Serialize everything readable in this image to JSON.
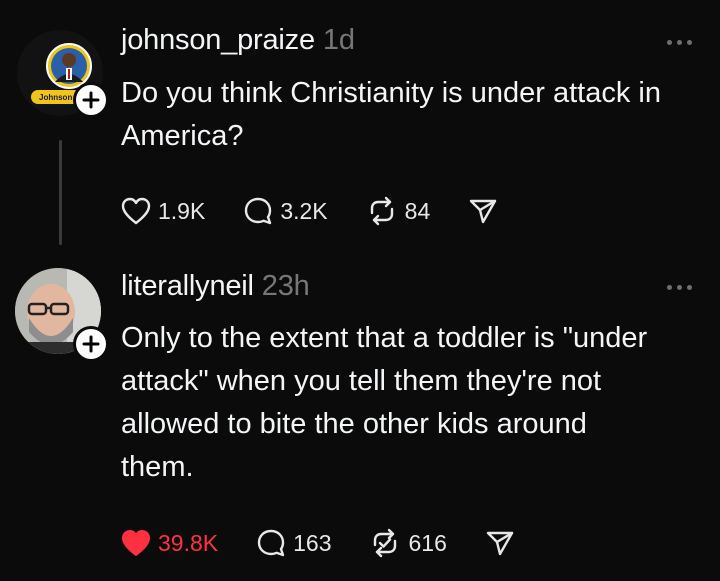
{
  "colors": {
    "background": "#0b0b0b",
    "text": "#f3f5f7",
    "muted": "#777777",
    "like_active": "#ff3040"
  },
  "posts": [
    {
      "username": "johnson_praize",
      "time": "1d",
      "avatar_label": "Johnson P",
      "text": "Do you think Christianity is under attack in America?",
      "likes": "1.9K",
      "liked": false,
      "replies": "3.2K",
      "reposts": "84",
      "icons": [
        "plus-icon",
        "more-icon",
        "heart-icon",
        "reply-icon",
        "repost-icon",
        "share-icon"
      ]
    },
    {
      "username": "literallyneil",
      "time": "23h",
      "text": "Only to the extent that a toddler is \"under attack\" when you tell them they're not allowed to bite the other kids around them.",
      "likes": "39.8K",
      "liked": true,
      "replies": "163",
      "reposts": "616",
      "icons": [
        "plus-icon",
        "more-icon",
        "heart-filled-icon",
        "reply-icon",
        "repost-check-icon",
        "share-icon"
      ]
    }
  ]
}
